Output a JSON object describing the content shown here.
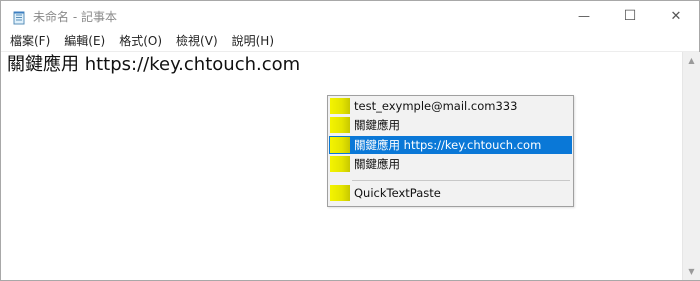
{
  "window": {
    "title": "未命名 - 記事本"
  },
  "caption_buttons": {
    "minimize": "—",
    "maximize": "☐",
    "close": "✕"
  },
  "menubar": {
    "items": [
      {
        "label": "檔案(F)"
      },
      {
        "label": "編輯(E)"
      },
      {
        "label": "格式(O)"
      },
      {
        "label": "檢視(V)"
      },
      {
        "label": "說明(H)"
      }
    ]
  },
  "editor": {
    "content": "關鍵應用 https://key.chtouch.com"
  },
  "popup": {
    "items": [
      {
        "label": "test_exymple@mail.com333",
        "selected": false
      },
      {
        "label": "關鍵應用",
        "selected": false
      },
      {
        "label": "關鍵應用 https://key.chtouch.com",
        "selected": true
      },
      {
        "label": "關鍵應用",
        "selected": false
      },
      {
        "label": "QuickTextPaste",
        "selected": false
      }
    ],
    "accent": "#e8e800",
    "selected_color": "#0a78d7"
  }
}
